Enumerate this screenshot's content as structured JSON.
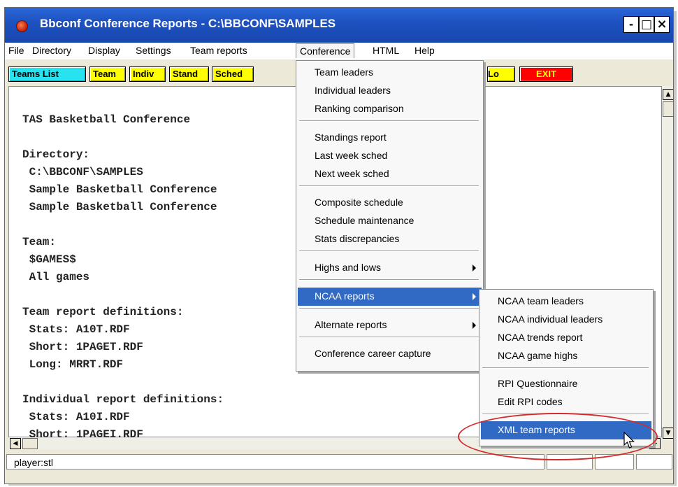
{
  "window": {
    "title": "Bbconf Conference Reports - C:\\BBCONF\\SAMPLES",
    "controls": {
      "minimize": "-",
      "maximize": "□",
      "close": "×"
    }
  },
  "menubar": [
    "File",
    "Directory",
    "Display",
    "Settings",
    "Team reports",
    "Conference",
    "HTML",
    "Help"
  ],
  "toolbar": [
    {
      "label": "Teams List",
      "bg": "#26e3ef"
    },
    {
      "label": "Team",
      "bg": "#ffff00"
    },
    {
      "label": "Indiv",
      "bg": "#ffff00"
    },
    {
      "label": "Stand",
      "bg": "#ffff00"
    },
    {
      "label": "Sched",
      "bg": "#ffff00"
    },
    {
      "label": "Lo",
      "bg": "#ffff00"
    },
    {
      "label": "EXIT",
      "bg": "#ff0000",
      "color": "#ffff00"
    }
  ],
  "content_lines": [
    "TAS Basketball Conference",
    "",
    "Directory:",
    " C:\\BBCONF\\SAMPLES",
    " Sample Basketball Conference",
    " Sample Basketball Conference",
    "",
    "Team:",
    " $GAMES$",
    " All games",
    "",
    "Team report definitions:",
    " Stats: A10T.RDF",
    " Short: 1PAGET.RDF",
    " Long: MRRT.RDF",
    "",
    "Individual report definitions:",
    " Stats: A10I.RDF",
    " Short: 1PAGEI.RDF"
  ],
  "conference_menu": {
    "groups": [
      [
        "Team leaders",
        "Individual leaders",
        "Ranking comparison"
      ],
      [
        "Standings report",
        "Last week sched",
        "Next week sched"
      ],
      [
        "Composite schedule",
        "Schedule maintenance",
        "Stats discrepancies"
      ],
      [
        "Highs and lows"
      ],
      [
        "NCAA reports"
      ],
      [
        "Alternate reports"
      ],
      [
        "Conference career capture"
      ]
    ],
    "highlighted": "NCAA reports",
    "submenu_items": [
      "Highs and lows",
      "NCAA reports",
      "Alternate reports"
    ]
  },
  "ncaa_submenu": {
    "groups": [
      [
        "NCAA team leaders",
        "NCAA individual leaders",
        "NCAA trends report",
        "NCAA game highs"
      ],
      [
        "RPI Questionnaire",
        "Edit RPI codes"
      ],
      [
        "XML team reports"
      ]
    ],
    "highlighted": "XML team reports"
  },
  "status": {
    "text": "player:stl"
  },
  "colors": {
    "highlight": "#316ac5",
    "annotation": "#d42a2a"
  }
}
